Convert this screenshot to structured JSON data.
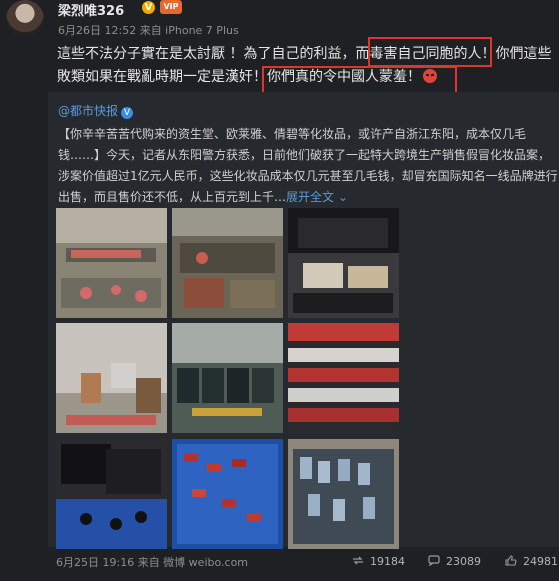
{
  "post": {
    "username": "梁烈唯326",
    "meta": "6月26日 12:52 来自 iPhone 7 Plus",
    "lines": [
      "這些不法分子實在是太討厭 ！為了自己的利益，而毒害自己同胞的人！你們這些",
      "敗類如果在戰亂時期一定是漢奸！你們真的令中國人蒙羞！"
    ]
  },
  "repost": {
    "author": "@都市快报",
    "lines": [
      "【你辛辛苦苦代购来的资生堂、欧莱雅、倩碧等化妆品，或许产自浙江东阳，成本仅几毛",
      "钱……】今天，记者从东阳警方获悉，日前他们破获了一起特大跨境生产销售假冒化妆品案，",
      "涉案价值超过1亿元人民币，这些化妆品成本仅几元甚至几毛钱，却冒充国际知名一线品牌进行",
      "出售，而且售价还不低，从上百元到上千…"
    ],
    "expand_label": "展开全文",
    "footer": "6月25日 19:16 来自 微博 weibo.com",
    "stats": {
      "reposts": "19184",
      "comments": "23089",
      "likes": "24981"
    }
  },
  "icons": [
    "verified-v-icon",
    "vip-badge-icon",
    "angry-face-emoji-icon",
    "repost-icon",
    "comment-icon",
    "like-icon"
  ],
  "colors": {
    "highlight": "#e0342f",
    "link": "#5a9ad8",
    "verified": "#f2a900"
  }
}
